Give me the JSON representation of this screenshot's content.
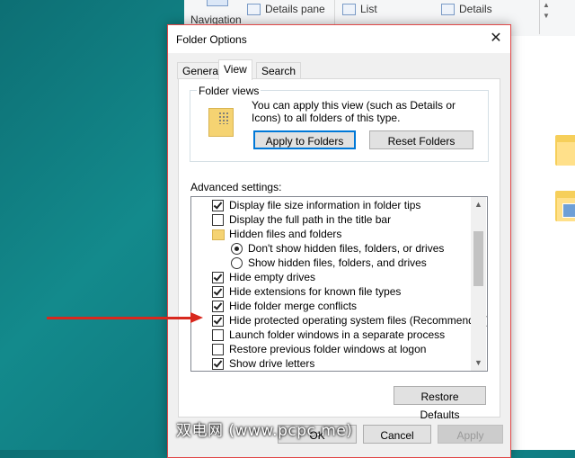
{
  "explorer": {
    "navigation_label": "Navigation",
    "details_pane_label": "Details pane",
    "list_label": "List",
    "details_label": "Details"
  },
  "dialog": {
    "title": "Folder Options",
    "tabs": [
      "General",
      "View",
      "Search"
    ],
    "active_tab": "View",
    "folder_views": {
      "legend": "Folder views",
      "description": "You can apply this view (such as Details or Icons) to all folders of this type.",
      "apply_button": "Apply to Folders",
      "reset_button": "Reset Folders"
    },
    "advanced_label": "Advanced settings:",
    "advanced_items": [
      {
        "type": "checkbox",
        "checked": true,
        "indent": 1,
        "label": "Display file size information in folder tips"
      },
      {
        "type": "checkbox",
        "checked": false,
        "indent": 1,
        "label": "Display the full path in the title bar"
      },
      {
        "type": "folder",
        "indent": 1,
        "label": "Hidden files and folders"
      },
      {
        "type": "radio",
        "checked": true,
        "indent": 2,
        "label": "Don't show hidden files, folders, or drives"
      },
      {
        "type": "radio",
        "checked": false,
        "indent": 2,
        "label": "Show hidden files, folders, and drives"
      },
      {
        "type": "checkbox",
        "checked": true,
        "indent": 1,
        "label": "Hide empty drives"
      },
      {
        "type": "checkbox",
        "checked": true,
        "indent": 1,
        "label": "Hide extensions for known file types"
      },
      {
        "type": "checkbox",
        "checked": true,
        "indent": 1,
        "label": "Hide folder merge conflicts"
      },
      {
        "type": "checkbox",
        "checked": true,
        "indent": 1,
        "label": "Hide protected operating system files (Recommended)"
      },
      {
        "type": "checkbox",
        "checked": false,
        "indent": 1,
        "label": "Launch folder windows in a separate process"
      },
      {
        "type": "checkbox",
        "checked": false,
        "indent": 1,
        "label": "Restore previous folder windows at logon"
      },
      {
        "type": "checkbox",
        "checked": true,
        "indent": 1,
        "label": "Show drive letters"
      }
    ],
    "restore_defaults_button": "Restore Defaults",
    "ok_button": "OK",
    "cancel_button": "Cancel",
    "apply_button": "Apply"
  },
  "watermark": "双电网 (www.pcpc.me)",
  "colors": {
    "annotation_arrow": "#d8281e",
    "dialog_border": "#e04848",
    "focus_blue": "#0078d7"
  }
}
